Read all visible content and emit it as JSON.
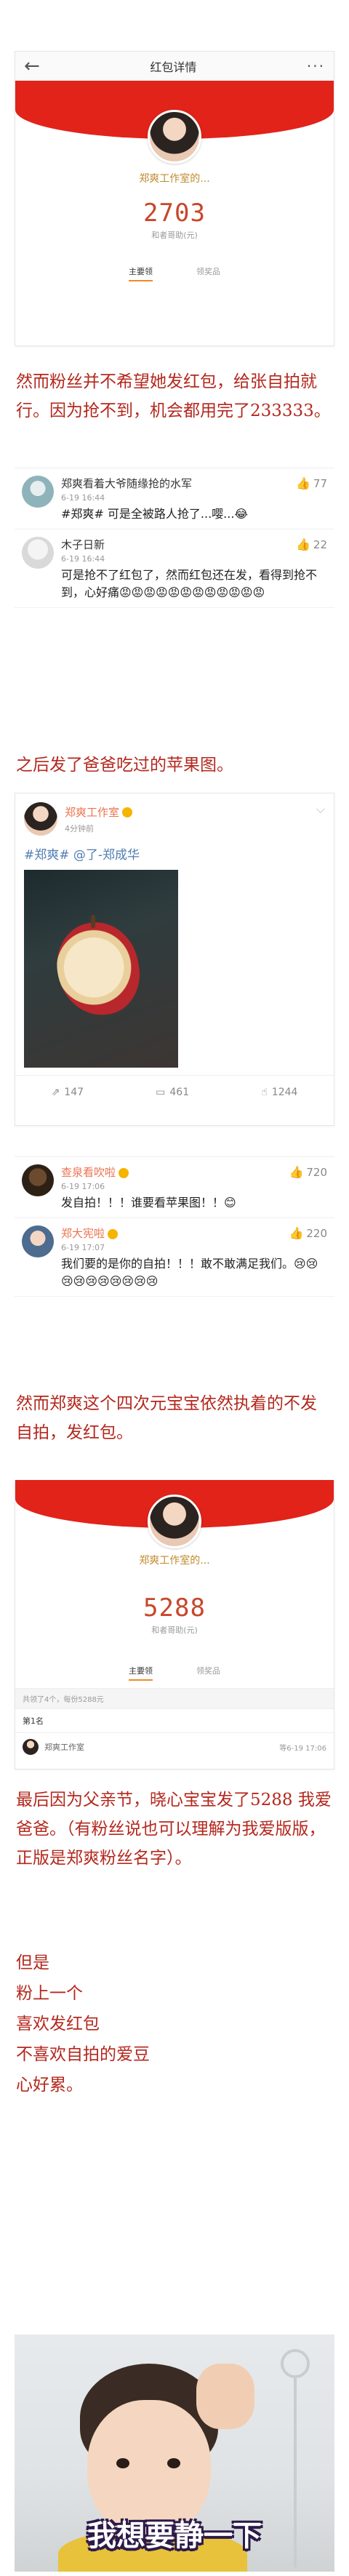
{
  "redpacket1": {
    "nav_title": "红包详情",
    "name": "郑爽工作室的...",
    "amount": "2703",
    "unit": "和者哥助(元)",
    "tab_received": "主要领",
    "tab_other": "领奖品"
  },
  "paragraph1": "然而粉丝并不希望她发红包，给张自拍就行。因为抢不到，机会都用完了233333。",
  "comments1": [
    {
      "name": "郑爽看着大爷随缘抢的水军",
      "time": "6-19 16:44",
      "text": "#郑爽# 可是全被路人抢了...嘤...😂",
      "likes": "77"
    },
    {
      "name": "木子日新",
      "time": "6-19 16:44",
      "text": "可是抢不了红包了，然而红包还在发，看得到抢不到，心好痛😡😡😡😡😡😡😡😡😡😡😡😡",
      "likes": "22"
    }
  ],
  "paragraph2": "之后发了爸爸吃过的苹果图。",
  "post": {
    "name": "郑爽工作室",
    "time": "4分钟前",
    "text": "#郑爽# @了-郑成华",
    "reposts": "147",
    "comments": "461",
    "likes": "1244"
  },
  "comments2": [
    {
      "name": "查泉看吹啦",
      "time": "6-19 17:06",
      "text": "发自拍！！！谁要看苹果图！！😊",
      "likes": "720"
    },
    {
      "name": "郑大宪啦",
      "time": "6-19 17:07",
      "text": "我们要的是你的自拍！！！敢不敢满足我们。😢😢😢😢😢😢😢😢😢😢",
      "likes": "220"
    }
  ],
  "paragraph3": "然而郑爽这个四次元宝宝依然执着的不发自拍，发红包。",
  "redpacket2": {
    "name": "郑爽工作室的...",
    "amount": "5288",
    "unit": "和者哥助(元)",
    "tab_received": "主要领",
    "tab_other": "领奖品",
    "list_info": "共领了4个，每份5288元",
    "list_header": "第1名",
    "row_name": "郑爽工作室",
    "row_time": "等6-19 17:06"
  },
  "paragraph4": "最后因为父亲节，晓心宝宝发了5288 我爱爸爸。（有粉丝说也可以理解为我爱版版，正版是郑爽粉丝名字）。",
  "final_lines": [
    "但是",
    "粉上一个",
    "喜欢发红包",
    "不喜欢自拍的爱豆",
    "心好累。"
  ],
  "meme_caption": "我想要静一下",
  "colors": {
    "accent_red": "#e2231a",
    "text_red": "#b4281e",
    "link_blue": "#507daf",
    "name_orange": "#eb7350"
  }
}
